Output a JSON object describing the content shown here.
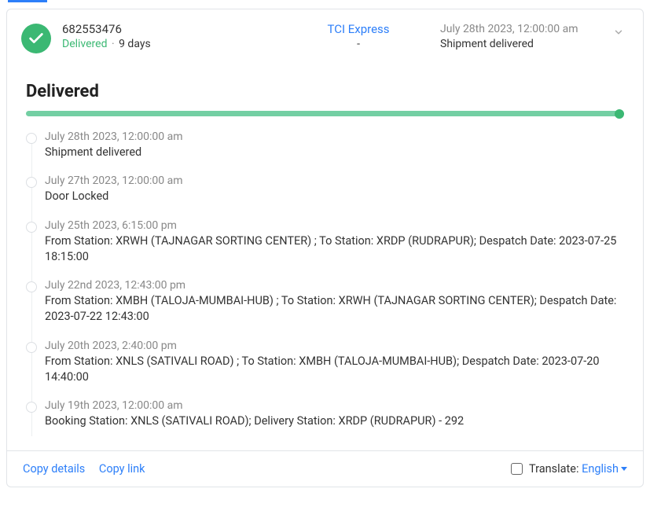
{
  "summary": {
    "tracking_number": "682553476",
    "status": "Delivered",
    "duration": "9 days",
    "carrier": "TCI Express",
    "carrier_sub": "-",
    "latest_date": "July 28th 2023, 12:00:00 am",
    "latest_message": "Shipment delivered"
  },
  "detail": {
    "title": "Delivered",
    "events": [
      {
        "date": "July 28th 2023, 12:00:00 am",
        "message": "Shipment delivered"
      },
      {
        "date": "July 27th 2023, 12:00:00 am",
        "message": "Door Locked"
      },
      {
        "date": "July 25th 2023, 6:15:00 pm",
        "message": "From Station: XRWH (TAJNAGAR SORTING CENTER) ; To Station: XRDP (RUDRAPUR); Despatch Date: 2023-07-25 18:15:00"
      },
      {
        "date": "July 22nd 2023, 12:43:00 pm",
        "message": "From Station: XMBH (TALOJA-MUMBAI-HUB) ; To Station: XRWH (TAJNAGAR SORTING CENTER); Despatch Date: 2023-07-22 12:43:00"
      },
      {
        "date": "July 20th 2023, 2:40:00 pm",
        "message": "From Station: XNLS (SATIVALI ROAD) ; To Station: XMBH (TALOJA-MUMBAI-HUB); Despatch Date: 2023-07-20 14:40:00"
      },
      {
        "date": "July 19th 2023, 12:00:00 am",
        "message": "Booking Station: XNLS (SATIVALI ROAD); Delivery Station: XRDP (RUDRAPUR) - 292"
      }
    ]
  },
  "footer": {
    "copy_details": "Copy details",
    "copy_link": "Copy link",
    "translate_label": "Translate:",
    "language": "English"
  }
}
